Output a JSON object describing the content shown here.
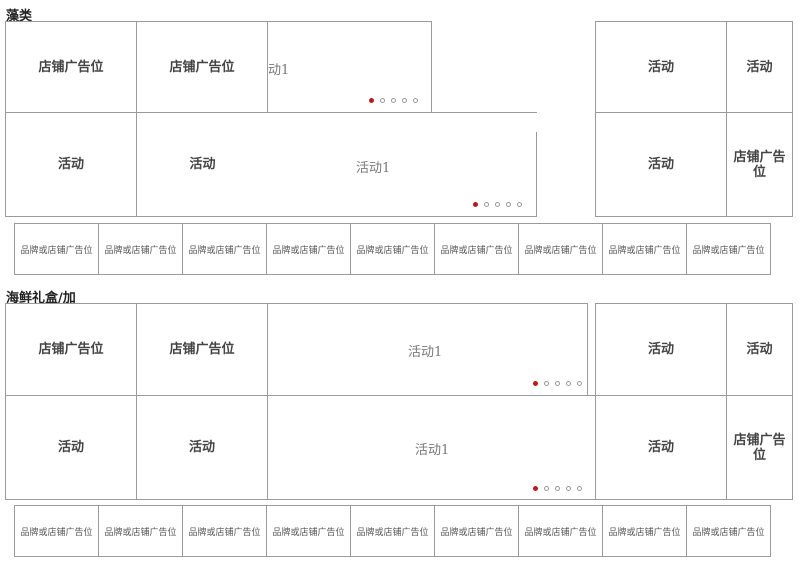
{
  "sections": [
    {
      "title": "藻类",
      "top_cells": [
        "店铺广告位",
        "店铺广告位"
      ],
      "slider_top": {
        "text": "动1",
        "dots": 5,
        "active": 0
      },
      "right_top": [
        "活动",
        "活动"
      ],
      "bottom_cells": [
        "活动",
        "活动"
      ],
      "slider_bottom": {
        "text": "活动1",
        "dots": 5,
        "active": 0
      },
      "right_bottom": [
        "活动",
        "店铺广告位"
      ],
      "brands": [
        "品牌或店铺广告位",
        "品牌或店铺广告位",
        "品牌或店铺广告位",
        "品牌或店铺广告位",
        "品牌或店铺广告位",
        "品牌或店铺广告位",
        "品牌或店铺广告位",
        "品牌或店铺广告位",
        "品牌或店铺广告位"
      ]
    },
    {
      "title": "海鲜礼盒/加",
      "top_cells": [
        "店铺广告位",
        "店铺广告位"
      ],
      "slider_top": {
        "text": "活动1",
        "dots": 5,
        "active": 0
      },
      "right_top": [
        "活动",
        "活动"
      ],
      "bottom_cells": [
        "活动",
        "活动"
      ],
      "slider_bottom": {
        "text": "活动1",
        "dots": 5,
        "active": 0
      },
      "right_bottom": [
        "活动",
        "店铺广告位"
      ],
      "brands": [
        "品牌或店铺广告位",
        "品牌或店铺广告位",
        "品牌或店铺广告位",
        "品牌或店铺广告位",
        "品牌或店铺广告位",
        "品牌或店铺广告位",
        "品牌或店铺广告位",
        "品牌或店铺广告位",
        "品牌或店铺广告位"
      ]
    }
  ],
  "colors": {
    "active_dot": "#c01818",
    "border": "#9a9a9a"
  }
}
